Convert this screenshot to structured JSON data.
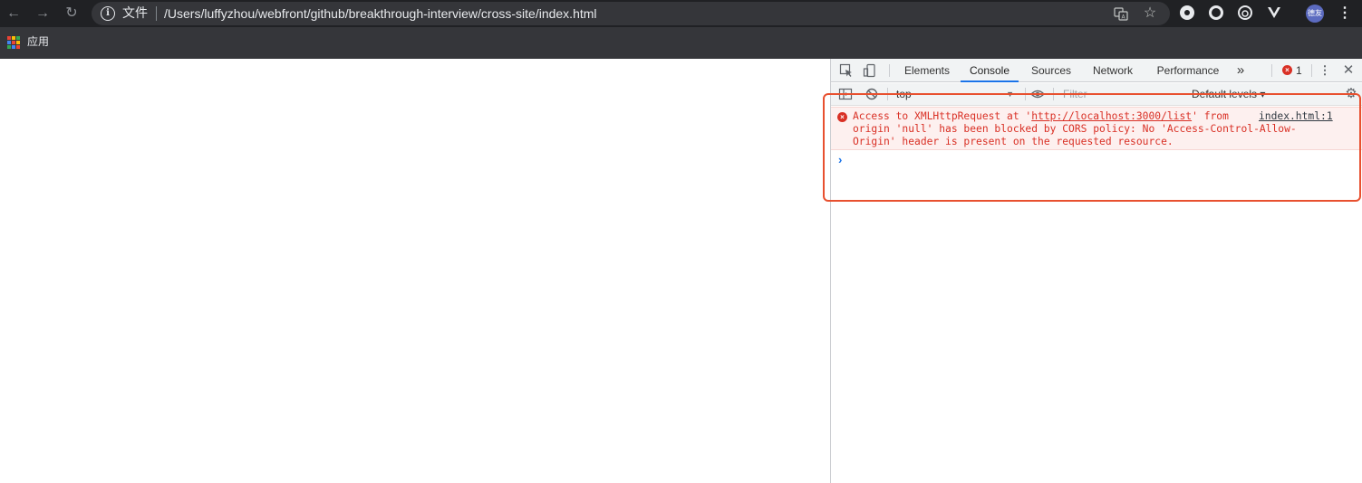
{
  "browser": {
    "omnibox": {
      "label": "文件",
      "url": "/Users/luffyzhou/webfront/github/breakthrough-interview/cross-site/index.html"
    },
    "nav": {
      "back": "←",
      "forward": "→",
      "reload": "↻"
    },
    "avatar_text": "德友",
    "bookmarks": {
      "apps_label": "应用"
    }
  },
  "devtools": {
    "tabs": [
      "Elements",
      "Console",
      "Sources",
      "Network",
      "Performance"
    ],
    "active_tab": "Console",
    "more_tabs": "»",
    "error_count": "1",
    "toolbar": {
      "context": "top",
      "filter_placeholder": "Filter",
      "levels": "Default levels ▾"
    },
    "console": {
      "error": {
        "line1_pre": "Access to XMLHttpRequest at '",
        "line1_url": "http://localhost:3000/list",
        "line1_post": "' from",
        "line2": "origin 'null' has been blocked by CORS policy: No 'Access-Control-Allow-",
        "line3": "Origin' header is present on the requested resource.",
        "source": "index.html:1"
      },
      "prompt": "›"
    }
  },
  "icons": {
    "info": "info-icon",
    "translate": "translate-icon",
    "star": "star-icon",
    "error": "error-icon"
  },
  "colors": {
    "accent": "#1a73e8",
    "error": "#d93025",
    "highlight": "#e8502f"
  }
}
